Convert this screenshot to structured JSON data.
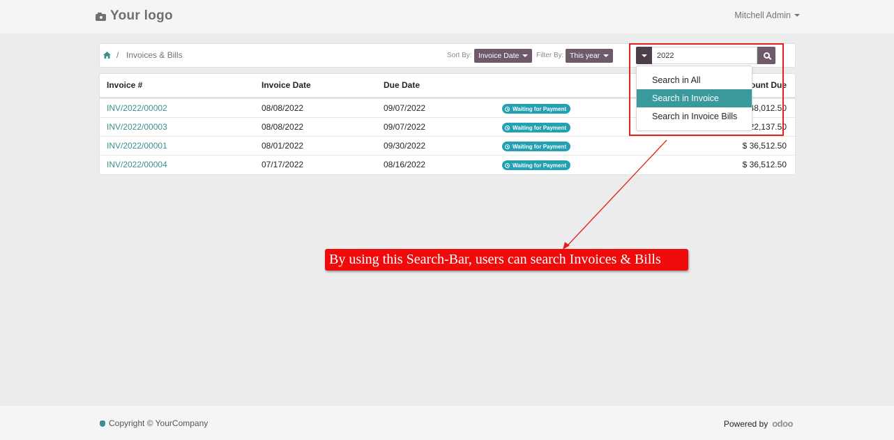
{
  "header": {
    "logo_text": "Your logo",
    "user_name": "Mitchell Admin"
  },
  "breadcrumb": {
    "current": "Invoices & Bills",
    "separator": "/"
  },
  "toolbar": {
    "sort_label": "Sort By:",
    "sort_value": "Invoice Date",
    "filter_label": "Filter By:",
    "filter_value": "This year",
    "search_value": "2022"
  },
  "search_menu": {
    "items": [
      {
        "label": "Search in All",
        "active": false
      },
      {
        "label": "Search in Invoice",
        "active": true
      },
      {
        "label": "Search in Invoice Bills",
        "active": false
      }
    ]
  },
  "table": {
    "headers": [
      "Invoice #",
      "Invoice Date",
      "Due Date",
      "Amount Due"
    ],
    "rows": [
      {
        "number": "INV/2022/00002",
        "invoice_date": "08/08/2022",
        "due_date": "09/07/2022",
        "status": "Waiting for Payment",
        "amount": "$ 48,012.50"
      },
      {
        "number": "INV/2022/00003",
        "invoice_date": "08/08/2022",
        "due_date": "09/07/2022",
        "status": "Waiting for Payment",
        "amount": "$ 22,137.50"
      },
      {
        "number": "INV/2022/00001",
        "invoice_date": "08/01/2022",
        "due_date": "09/30/2022",
        "status": "Waiting for Payment",
        "amount": "$ 36,512.50"
      },
      {
        "number": "INV/2022/00004",
        "invoice_date": "07/17/2022",
        "due_date": "08/16/2022",
        "status": "Waiting for Payment",
        "amount": "$ 36,512.50"
      }
    ]
  },
  "annotation": {
    "text": "By using this Search-Bar, users can search Invoices & Bills",
    "color": "#ef0b0b"
  },
  "footer": {
    "copyright": "Copyright © YourCompany",
    "powered_by": "Powered by",
    "brand": "odoo"
  },
  "colors": {
    "accent": "#3a9a9b",
    "button": "#6f5a6b",
    "badge": "#22a1b3"
  }
}
